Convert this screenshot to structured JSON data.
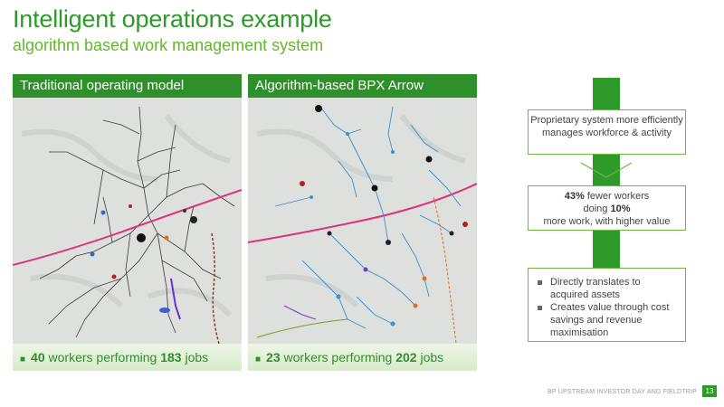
{
  "slide": {
    "title": "Intelligent operations example",
    "subtitle": "algorithm based work management system"
  },
  "left_panel": {
    "header": "Traditional operating model",
    "footer": {
      "workers": "40",
      "mid": "workers performing",
      "jobs": "183",
      "tail": "jobs"
    }
  },
  "right_panel": {
    "header": "Algorithm-based BPX Arrow",
    "footer": {
      "workers": "23",
      "mid": "workers performing",
      "jobs": "202",
      "tail": "jobs"
    }
  },
  "callouts": {
    "box1": "Proprietary system more efficiently manages workforce & activity",
    "box2": {
      "pct": "43%",
      "line1": "fewer workers",
      "doing": "doing",
      "more": "10%",
      "line3": "more work, with higher value"
    },
    "box3_items": [
      "Directly translates to acquired assets",
      "Creates value through cost savings and revenue maximisation"
    ]
  },
  "footer": {
    "label": "BP UPSTREAM INVESTOR DAY AND FIELDTRIP",
    "page": "13"
  },
  "colors": {
    "brand_green": "#2e9a2a",
    "light_green": "#62b82b",
    "highway": "#e0307a"
  }
}
